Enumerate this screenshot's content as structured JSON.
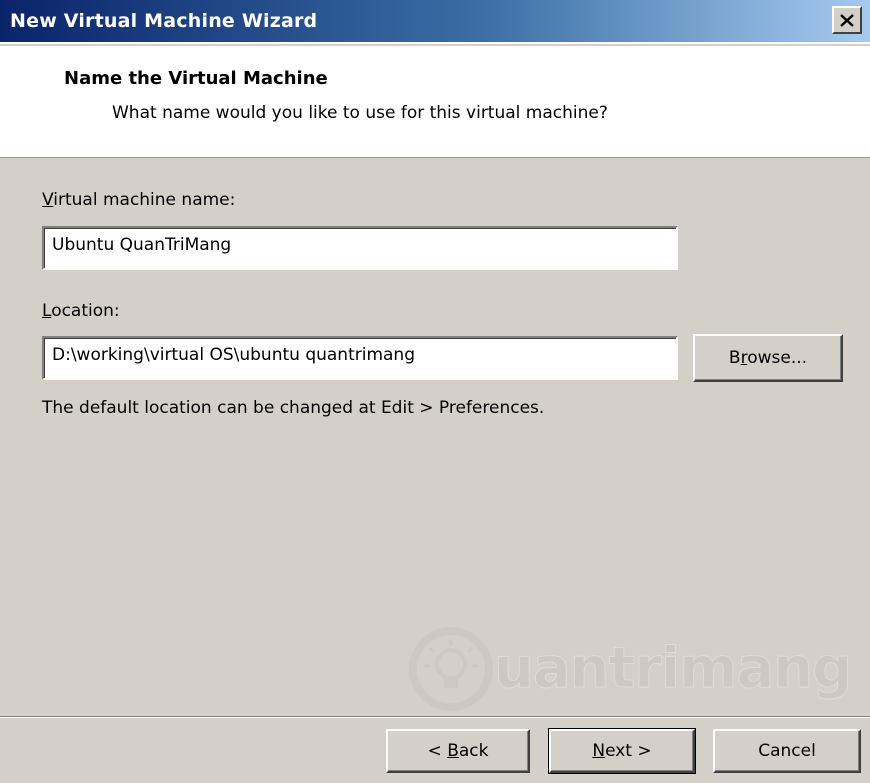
{
  "window": {
    "title": "New Virtual Machine Wizard"
  },
  "header": {
    "title": "Name the Virtual Machine",
    "subtitle": "What name would you like to use for this virtual machine?"
  },
  "form": {
    "vm_name_label_mnemonic": "V",
    "vm_name_label_rest": "irtual machine name:",
    "vm_name_value": "Ubuntu QuanTriMang",
    "location_label_mnemonic": "L",
    "location_label_rest": "ocation:",
    "location_value": "D:\\working\\virtual OS\\ubuntu quantrimang",
    "browse_label_pre": "B",
    "browse_label_mnemonic": "r",
    "browse_label_post": "owse...",
    "info_text": "The default location can be changed at Edit > Preferences."
  },
  "footer": {
    "back_pre": "< ",
    "back_mnemonic": "B",
    "back_post": "ack",
    "next_mnemonic": "N",
    "next_post": "ext >",
    "cancel_label": "Cancel"
  },
  "watermark": {
    "text": "uantrimang"
  },
  "colors": {
    "titlebar_start": "#0a246a",
    "titlebar_end": "#a6caf0",
    "dialog_bg": "#d4d0c8"
  }
}
